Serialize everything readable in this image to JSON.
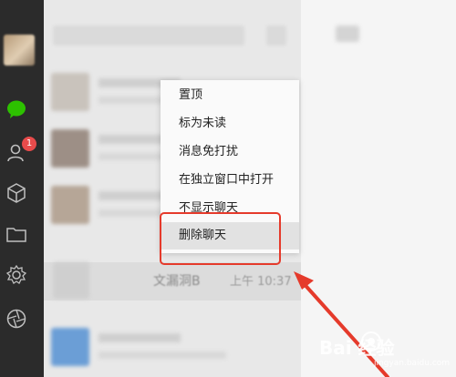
{
  "sidebar": {
    "badge": "1"
  },
  "chat_list": {
    "hovered_row": {
      "name": "文漏洞B",
      "time": "上午 10:37"
    }
  },
  "context_menu": {
    "items": [
      {
        "label": "置顶"
      },
      {
        "label": "标为未读"
      },
      {
        "label": "消息免打扰"
      },
      {
        "label": "在独立窗口中打开"
      },
      {
        "label": "不显示聊天"
      },
      {
        "label": "删除聊天"
      }
    ],
    "highlighted": "删除聊天"
  },
  "watermark": {
    "text": "Bai 经验",
    "url": "jingyan.baidu.com"
  },
  "colors": {
    "sidebar": "#2b2b2b",
    "chat_icon": "#2dc100",
    "badge": "#e84b4b",
    "highlight_box": "#e53a2b",
    "arrow": "#e53a2b"
  }
}
